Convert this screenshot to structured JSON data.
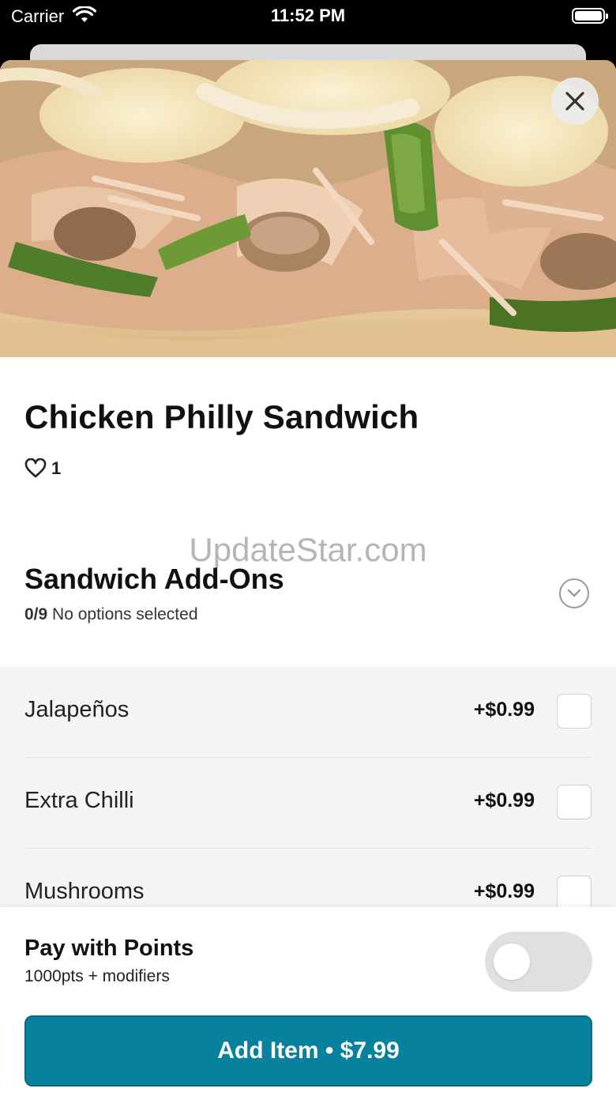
{
  "status_bar": {
    "carrier": "Carrier",
    "time": "11:52 PM"
  },
  "hero": {
    "alt": "Chicken Philly Sandwich photo"
  },
  "item": {
    "title": "Chicken Philly Sandwich",
    "likes": "1"
  },
  "watermark": "UpdateStar.com",
  "modifier_group": {
    "title": "Sandwich Add-Ons",
    "count": "0/9",
    "status": "No options selected"
  },
  "options": [
    {
      "name": "Jalapeños",
      "price": "+$0.99"
    },
    {
      "name": "Extra Chilli",
      "price": "+$0.99"
    },
    {
      "name": "Mushrooms",
      "price": "+$0.99"
    }
  ],
  "points": {
    "title": "Pay with Points",
    "subtitle": "1000pts + modifiers",
    "enabled": false
  },
  "add_button": {
    "label": "Add Item • $7.99"
  },
  "colors": {
    "accent": "#08819e",
    "toggle_off": "#e0e0e0",
    "options_bg": "#f5f5f5"
  },
  "icons": [
    "wifi-icon",
    "battery-icon",
    "close-icon",
    "heart-icon",
    "chevron-down-icon"
  ]
}
